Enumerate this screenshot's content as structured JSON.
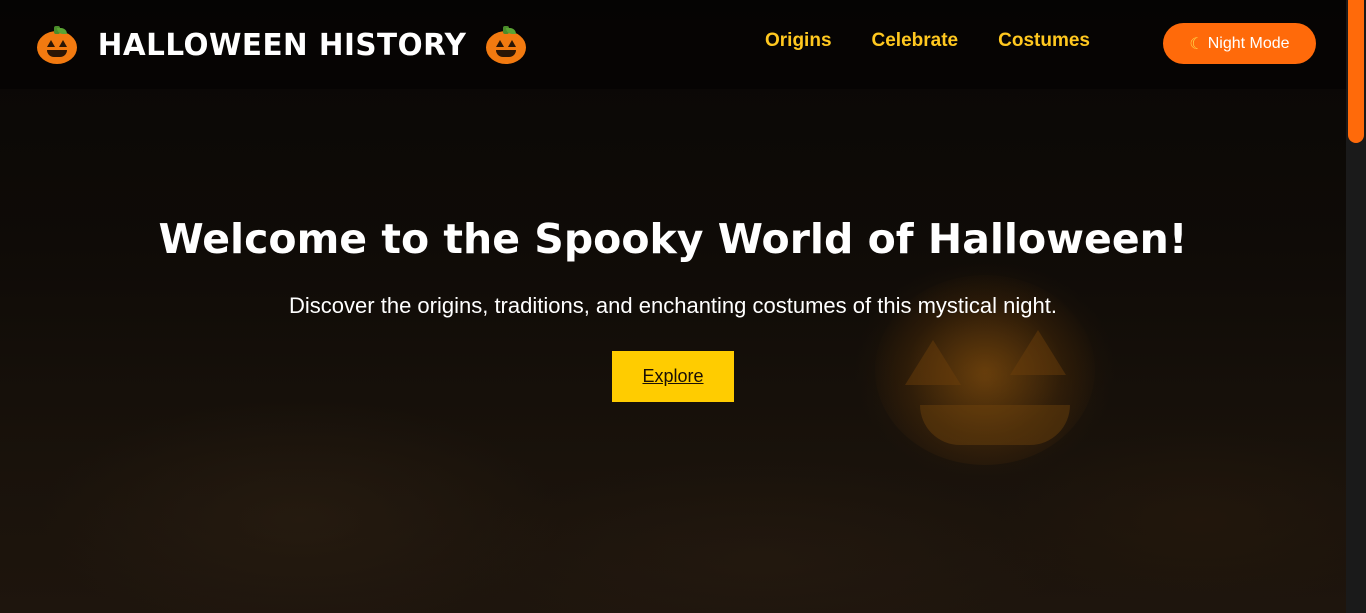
{
  "navbar": {
    "brand_title": "HALLOWEEN HISTORY",
    "links": [
      {
        "label": "Origins"
      },
      {
        "label": "Celebrate"
      },
      {
        "label": "Costumes"
      }
    ],
    "night_mode_label": "Night Mode",
    "night_mode_icon": "moon-icon"
  },
  "hero": {
    "title": "Welcome to the Spooky World of Halloween!",
    "subtitle": "Discover the origins, traditions, and enchanting costumes of this mystical night.",
    "cta_label": "Explore"
  },
  "colors": {
    "accent_orange": "#ff6a0a",
    "accent_yellow": "#ffcc00",
    "nav_link": "#ffc81f",
    "background": "#0d0906"
  }
}
